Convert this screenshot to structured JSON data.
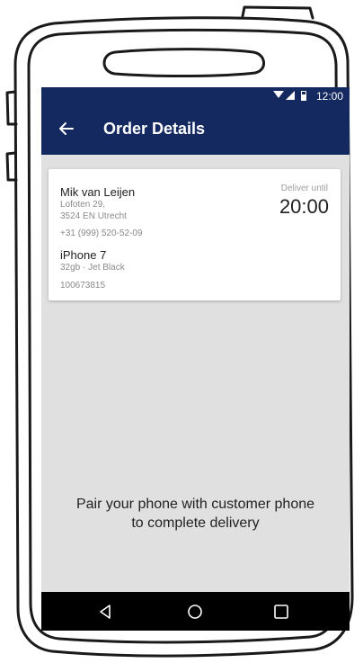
{
  "status_bar": {
    "time": "12:00",
    "icons": [
      "wifi-icon",
      "signal-icon",
      "battery-icon"
    ]
  },
  "app_bar": {
    "title": "Order Details",
    "back_icon": "back-arrow-icon"
  },
  "order_card": {
    "customer_name": "Mik van Leijen",
    "address_line1": "Lofoten 29,",
    "address_line2": "3524 EN  Utrecht",
    "phone": "+31 (999) 520-52-09",
    "product_name": "iPhone 7",
    "product_variant": "32gb · Jet Black",
    "order_number": "100673815",
    "deliver_label": "Deliver until",
    "deliver_time": "20:00"
  },
  "message": {
    "line1": "Pair your phone with customer phone",
    "line2": "to complete delivery"
  },
  "nav_bar": {
    "buttons": [
      "back-triangle-icon",
      "home-circle-icon",
      "recents-square-icon"
    ]
  },
  "colors": {
    "app_bar": "#14295f",
    "screen_bg": "#e0e0e0",
    "nav_bar": "#000000"
  }
}
